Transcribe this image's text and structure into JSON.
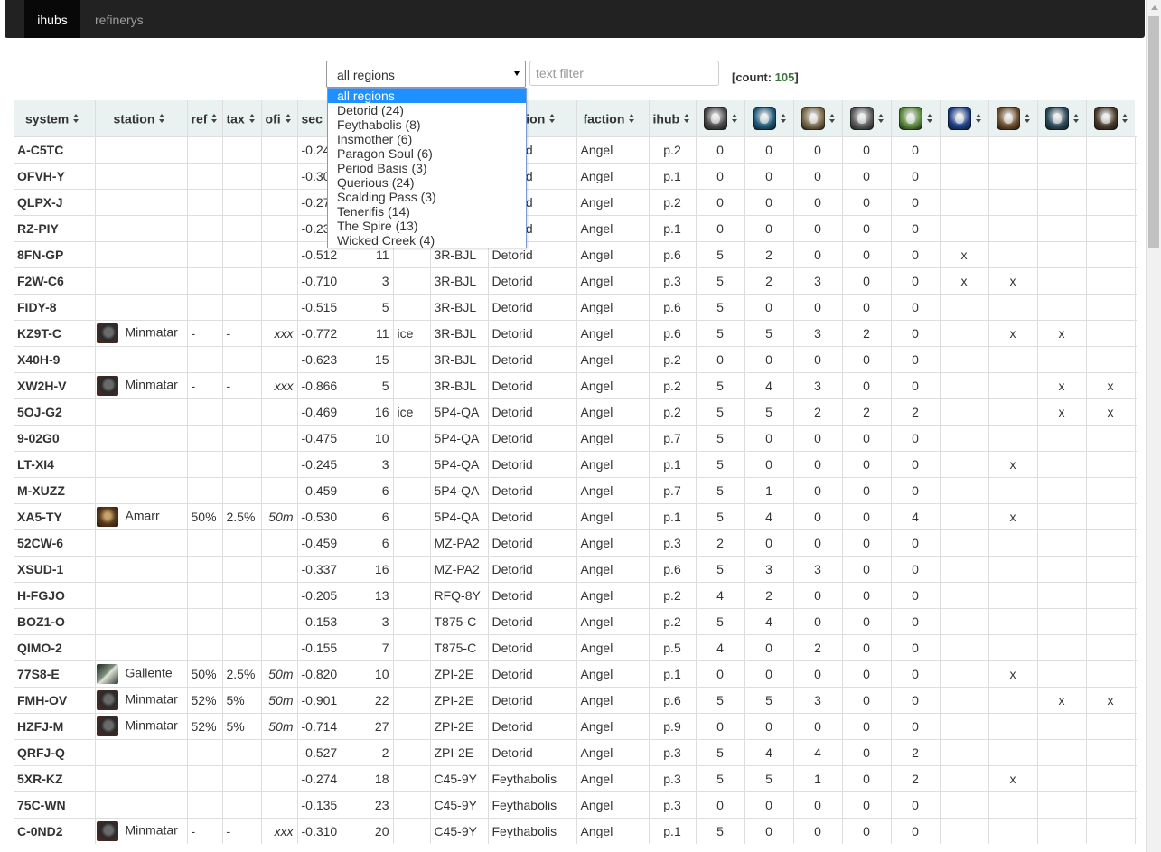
{
  "nav": {
    "tabs": [
      {
        "label": "ihubs",
        "active": true
      },
      {
        "label": "refinerys",
        "active": false
      }
    ]
  },
  "filters": {
    "region_selected": "all regions",
    "region_options": [
      "all regions",
      "Detorid (24)",
      "Feythabolis (8)",
      "Insmother (6)",
      "Paragon Soul (6)",
      "Period Basis (3)",
      "Querious (24)",
      "Scalding Pass (3)",
      "Tenerifis (14)",
      "The Spire (13)",
      "Wicked Creek (4)"
    ],
    "text_placeholder": "text filter",
    "count_label": "[count: ",
    "count_value": "105",
    "count_close": "]"
  },
  "table": {
    "columns": [
      "system",
      "station",
      "ref",
      "tax",
      "ofi",
      "sec",
      "",
      "",
      "",
      "region",
      "faction",
      "ihub"
    ],
    "rat_icons": [
      {
        "name": "angel-cartel-icon",
        "color": "#4a4a4a"
      },
      {
        "name": "blood-raiders-icon",
        "color": "#1e5a7a"
      },
      {
        "name": "guristas-icon",
        "color": "#7a6a4a"
      },
      {
        "name": "sanshas-nation-icon",
        "color": "#5a5a5a"
      },
      {
        "name": "serpentis-icon",
        "color": "#5a8a3a"
      },
      {
        "name": "rogue-drones-icon",
        "color": "#1c3f8a"
      },
      {
        "name": "mordus-legion-icon",
        "color": "#6a4a2a"
      },
      {
        "name": "drifters-icon",
        "color": "#2a4a5a"
      },
      {
        "name": "triglavian-icon",
        "color": "#4a3a2a"
      }
    ],
    "rows": [
      {
        "system": "A-C5TC",
        "owner": "",
        "owner_name": "",
        "ref": "",
        "tax": "",
        "ofi": "",
        "sec": "-0.24",
        "n": "",
        "ice": "",
        "con": "",
        "region": "Detorid",
        "faction": "Angel",
        "ihub": "p.2",
        "a": "0",
        "b": "0",
        "c": "0",
        "d": "0",
        "e": "0",
        "x": [
          "",
          "",
          "",
          "",
          ""
        ]
      },
      {
        "system": "OFVH-Y",
        "owner": "",
        "owner_name": "",
        "ref": "",
        "tax": "",
        "ofi": "",
        "sec": "-0.30",
        "n": "",
        "ice": "",
        "con": "",
        "region": "Detorid",
        "faction": "Angel",
        "ihub": "p.1",
        "a": "0",
        "b": "0",
        "c": "0",
        "d": "0",
        "e": "0",
        "x": [
          "",
          "",
          "",
          "",
          ""
        ]
      },
      {
        "system": "QLPX-J",
        "owner": "",
        "owner_name": "",
        "ref": "",
        "tax": "",
        "ofi": "",
        "sec": "-0.27",
        "n": "",
        "ice": "",
        "con": "",
        "region": "Detorid",
        "faction": "Angel",
        "ihub": "p.2",
        "a": "0",
        "b": "0",
        "c": "0",
        "d": "0",
        "e": "0",
        "x": [
          "",
          "",
          "",
          "",
          ""
        ]
      },
      {
        "system": "RZ-PIY",
        "owner": "",
        "owner_name": "",
        "ref": "",
        "tax": "",
        "ofi": "",
        "sec": "-0.23",
        "n": "",
        "ice": "",
        "con": "",
        "region": "Detorid",
        "faction": "Angel",
        "ihub": "p.1",
        "a": "0",
        "b": "0",
        "c": "0",
        "d": "0",
        "e": "0",
        "x": [
          "",
          "",
          "",
          "",
          ""
        ]
      },
      {
        "system": "8FN-GP",
        "owner": "",
        "owner_name": "",
        "ref": "",
        "tax": "",
        "ofi": "",
        "sec": "-0.512",
        "n": "11",
        "ice": "",
        "con": "3R-BJL",
        "region": "Detorid",
        "faction": "Angel",
        "ihub": "p.6",
        "a": "5",
        "b": "2",
        "c": "0",
        "d": "0",
        "e": "0",
        "x": [
          "x",
          "",
          "",
          "",
          ""
        ]
      },
      {
        "system": "F2W-C6",
        "owner": "",
        "owner_name": "",
        "ref": "",
        "tax": "",
        "ofi": "",
        "sec": "-0.710",
        "n": "3",
        "ice": "",
        "con": "3R-BJL",
        "region": "Detorid",
        "faction": "Angel",
        "ihub": "p.3",
        "a": "5",
        "b": "2",
        "c": "3",
        "d": "0",
        "e": "0",
        "x": [
          "x",
          "x",
          "",
          "",
          ""
        ]
      },
      {
        "system": "FIDY-8",
        "owner": "",
        "owner_name": "",
        "ref": "",
        "tax": "",
        "ofi": "",
        "sec": "-0.515",
        "n": "5",
        "ice": "",
        "con": "3R-BJL",
        "region": "Detorid",
        "faction": "Angel",
        "ihub": "p.6",
        "a": "5",
        "b": "0",
        "c": "0",
        "d": "0",
        "e": "0",
        "x": [
          "",
          "",
          "",
          "",
          ""
        ]
      },
      {
        "system": "KZ9T-C",
        "owner": "minmatar",
        "owner_name": "Minmatar",
        "ref": "-",
        "tax": "-",
        "ofi": "xxx",
        "sec": "-0.772",
        "n": "11",
        "ice": "ice",
        "con": "3R-BJL",
        "region": "Detorid",
        "faction": "Angel",
        "ihub": "p.6",
        "a": "5",
        "b": "5",
        "c": "3",
        "d": "2",
        "e": "0",
        "x": [
          "",
          "x",
          "x",
          "",
          ""
        ]
      },
      {
        "system": "X40H-9",
        "owner": "",
        "owner_name": "",
        "ref": "",
        "tax": "",
        "ofi": "",
        "sec": "-0.623",
        "n": "15",
        "ice": "",
        "con": "3R-BJL",
        "region": "Detorid",
        "faction": "Angel",
        "ihub": "p.2",
        "a": "0",
        "b": "0",
        "c": "0",
        "d": "0",
        "e": "0",
        "x": [
          "",
          "",
          "",
          "",
          ""
        ]
      },
      {
        "system": "XW2H-V",
        "owner": "minmatar",
        "owner_name": "Minmatar",
        "ref": "-",
        "tax": "-",
        "ofi": "xxx",
        "sec": "-0.866",
        "n": "5",
        "ice": "",
        "con": "3R-BJL",
        "region": "Detorid",
        "faction": "Angel",
        "ihub": "p.2",
        "a": "5",
        "b": "4",
        "c": "3",
        "d": "0",
        "e": "0",
        "x": [
          "",
          "",
          "x",
          "x",
          ""
        ]
      },
      {
        "system": "5OJ-G2",
        "owner": "",
        "owner_name": "",
        "ref": "",
        "tax": "",
        "ofi": "",
        "sec": "-0.469",
        "n": "16",
        "ice": "ice",
        "con": "5P4-QA",
        "region": "Detorid",
        "faction": "Angel",
        "ihub": "p.2",
        "a": "5",
        "b": "5",
        "c": "2",
        "d": "2",
        "e": "2",
        "x": [
          "",
          "",
          "x",
          "x",
          ""
        ]
      },
      {
        "system": "9-02G0",
        "owner": "",
        "owner_name": "",
        "ref": "",
        "tax": "",
        "ofi": "",
        "sec": "-0.475",
        "n": "10",
        "ice": "",
        "con": "5P4-QA",
        "region": "Detorid",
        "faction": "Angel",
        "ihub": "p.7",
        "a": "5",
        "b": "0",
        "c": "0",
        "d": "0",
        "e": "0",
        "x": [
          "",
          "",
          "",
          "",
          ""
        ]
      },
      {
        "system": "LT-XI4",
        "owner": "",
        "owner_name": "",
        "ref": "",
        "tax": "",
        "ofi": "",
        "sec": "-0.245",
        "n": "3",
        "ice": "",
        "con": "5P4-QA",
        "region": "Detorid",
        "faction": "Angel",
        "ihub": "p.1",
        "a": "5",
        "b": "0",
        "c": "0",
        "d": "0",
        "e": "0",
        "x": [
          "",
          "x",
          "",
          "",
          ""
        ]
      },
      {
        "system": "M-XUZZ",
        "owner": "",
        "owner_name": "",
        "ref": "",
        "tax": "",
        "ofi": "",
        "sec": "-0.459",
        "n": "6",
        "ice": "",
        "con": "5P4-QA",
        "region": "Detorid",
        "faction": "Angel",
        "ihub": "p.7",
        "a": "5",
        "b": "1",
        "c": "0",
        "d": "0",
        "e": "0",
        "x": [
          "",
          "",
          "",
          "",
          ""
        ]
      },
      {
        "system": "XA5-TY",
        "owner": "amarr",
        "owner_name": "Amarr",
        "ref": "50%",
        "tax": "2.5%",
        "ofi": "50m",
        "sec": "-0.530",
        "n": "6",
        "ice": "",
        "con": "5P4-QA",
        "region": "Detorid",
        "faction": "Angel",
        "ihub": "p.1",
        "a": "5",
        "b": "4",
        "c": "0",
        "d": "0",
        "e": "4",
        "x": [
          "",
          "x",
          "",
          "",
          ""
        ]
      },
      {
        "system": "52CW-6",
        "owner": "",
        "owner_name": "",
        "ref": "",
        "tax": "",
        "ofi": "",
        "sec": "-0.459",
        "n": "6",
        "ice": "",
        "con": "MZ-PA2",
        "region": "Detorid",
        "faction": "Angel",
        "ihub": "p.3",
        "a": "2",
        "b": "0",
        "c": "0",
        "d": "0",
        "e": "0",
        "x": [
          "",
          "",
          "",
          "",
          ""
        ]
      },
      {
        "system": "XSUD-1",
        "owner": "",
        "owner_name": "",
        "ref": "",
        "tax": "",
        "ofi": "",
        "sec": "-0.337",
        "n": "16",
        "ice": "",
        "con": "MZ-PA2",
        "region": "Detorid",
        "faction": "Angel",
        "ihub": "p.6",
        "a": "5",
        "b": "3",
        "c": "3",
        "d": "0",
        "e": "0",
        "x": [
          "",
          "",
          "",
          "",
          ""
        ]
      },
      {
        "system": "H-FGJO",
        "owner": "",
        "owner_name": "",
        "ref": "",
        "tax": "",
        "ofi": "",
        "sec": "-0.205",
        "n": "13",
        "ice": "",
        "con": "RFQ-8Y",
        "region": "Detorid",
        "faction": "Angel",
        "ihub": "p.2",
        "a": "4",
        "b": "2",
        "c": "0",
        "d": "0",
        "e": "0",
        "x": [
          "",
          "",
          "",
          "",
          ""
        ]
      },
      {
        "system": "BOZ1-O",
        "owner": "",
        "owner_name": "",
        "ref": "",
        "tax": "",
        "ofi": "",
        "sec": "-0.153",
        "n": "3",
        "ice": "",
        "con": "T875-C",
        "region": "Detorid",
        "faction": "Angel",
        "ihub": "p.2",
        "a": "5",
        "b": "4",
        "c": "0",
        "d": "0",
        "e": "0",
        "x": [
          "",
          "",
          "",
          "",
          ""
        ]
      },
      {
        "system": "QIMO-2",
        "owner": "",
        "owner_name": "",
        "ref": "",
        "tax": "",
        "ofi": "",
        "sec": "-0.155",
        "n": "7",
        "ice": "",
        "con": "T875-C",
        "region": "Detorid",
        "faction": "Angel",
        "ihub": "p.5",
        "a": "4",
        "b": "0",
        "c": "2",
        "d": "0",
        "e": "0",
        "x": [
          "",
          "",
          "",
          "",
          ""
        ]
      },
      {
        "system": "77S8-E",
        "owner": "gallente",
        "owner_name": "Gallente",
        "ref": "50%",
        "tax": "2.5%",
        "ofi": "50m",
        "sec": "-0.820",
        "n": "10",
        "ice": "",
        "con": "ZPI-2E",
        "region": "Detorid",
        "faction": "Angel",
        "ihub": "p.1",
        "a": "0",
        "b": "0",
        "c": "0",
        "d": "0",
        "e": "0",
        "x": [
          "",
          "x",
          "",
          "",
          ""
        ]
      },
      {
        "system": "FMH-OV",
        "owner": "minmatar",
        "owner_name": "Minmatar",
        "ref": "52%",
        "tax": "5%",
        "ofi": "50m",
        "sec": "-0.901",
        "n": "22",
        "ice": "",
        "con": "ZPI-2E",
        "region": "Detorid",
        "faction": "Angel",
        "ihub": "p.6",
        "a": "5",
        "b": "5",
        "c": "3",
        "d": "0",
        "e": "0",
        "x": [
          "",
          "",
          "x",
          "x",
          ""
        ]
      },
      {
        "system": "HZFJ-M",
        "owner": "minmatar",
        "owner_name": "Minmatar",
        "ref": "52%",
        "tax": "5%",
        "ofi": "50m",
        "sec": "-0.714",
        "n": "27",
        "ice": "",
        "con": "ZPI-2E",
        "region": "Detorid",
        "faction": "Angel",
        "ihub": "p.9",
        "a": "0",
        "b": "0",
        "c": "0",
        "d": "0",
        "e": "0",
        "x": [
          "",
          "",
          "",
          "",
          ""
        ]
      },
      {
        "system": "QRFJ-Q",
        "owner": "",
        "owner_name": "",
        "ref": "",
        "tax": "",
        "ofi": "",
        "sec": "-0.527",
        "n": "2",
        "ice": "",
        "con": "ZPI-2E",
        "region": "Detorid",
        "faction": "Angel",
        "ihub": "p.3",
        "a": "5",
        "b": "4",
        "c": "4",
        "d": "0",
        "e": "2",
        "x": [
          "",
          "",
          "",
          "",
          ""
        ]
      },
      {
        "system": "5XR-KZ",
        "owner": "",
        "owner_name": "",
        "ref": "",
        "tax": "",
        "ofi": "",
        "sec": "-0.274",
        "n": "18",
        "ice": "",
        "con": "C45-9Y",
        "region": "Feythabolis",
        "faction": "Angel",
        "ihub": "p.3",
        "a": "5",
        "b": "5",
        "c": "1",
        "d": "0",
        "e": "2",
        "x": [
          "",
          "x",
          "",
          "",
          ""
        ]
      },
      {
        "system": "75C-WN",
        "owner": "",
        "owner_name": "",
        "ref": "",
        "tax": "",
        "ofi": "",
        "sec": "-0.135",
        "n": "23",
        "ice": "",
        "con": "C45-9Y",
        "region": "Feythabolis",
        "faction": "Angel",
        "ihub": "p.3",
        "a": "0",
        "b": "0",
        "c": "0",
        "d": "0",
        "e": "0",
        "x": [
          "",
          "",
          "",
          "",
          ""
        ]
      },
      {
        "system": "C-0ND2",
        "owner": "minmatar",
        "owner_name": "Minmatar",
        "ref": "-",
        "tax": "-",
        "ofi": "xxx",
        "sec": "-0.310",
        "n": "20",
        "ice": "",
        "con": "C45-9Y",
        "region": "Feythabolis",
        "faction": "Angel",
        "ihub": "p.1",
        "a": "5",
        "b": "0",
        "c": "0",
        "d": "0",
        "e": "0",
        "x": [
          "",
          "",
          "",
          "",
          ""
        ]
      }
    ]
  }
}
